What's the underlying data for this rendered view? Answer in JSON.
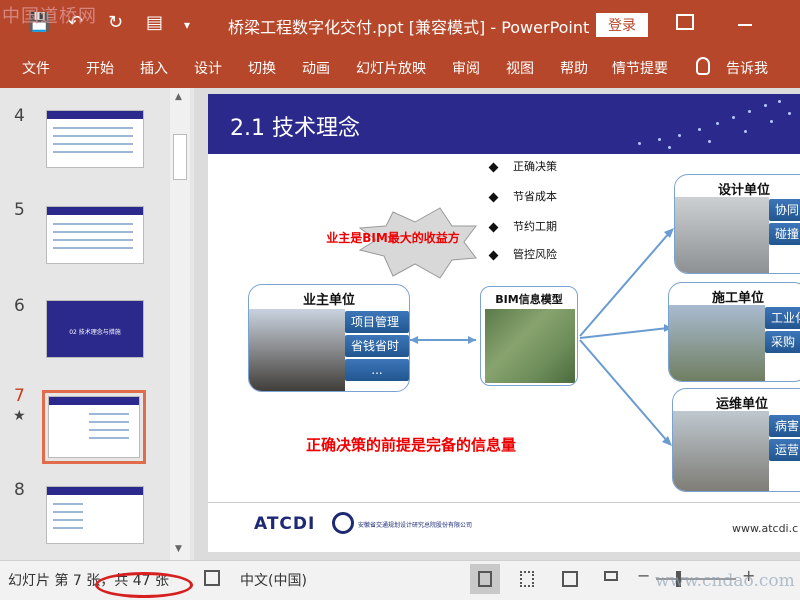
{
  "app": {
    "title": "桥梁工程数字化交付.ppt [兼容模式]  -  PowerPoint",
    "login_label": "登录",
    "watermark": "中国道桥网"
  },
  "ribbon": {
    "tabs": [
      "文件",
      "开始",
      "插入",
      "设计",
      "切换",
      "动画",
      "幻灯片放映",
      "审阅",
      "视图",
      "帮助",
      "情节提要"
    ],
    "tell_me": "告诉我"
  },
  "thumbnails": [
    {
      "num": "4"
    },
    {
      "num": "5"
    },
    {
      "num": "6",
      "caption": "02 技术理念与措施"
    },
    {
      "num": "7",
      "selected": true
    },
    {
      "num": "8"
    }
  ],
  "slide": {
    "title": "2.1 技术理念",
    "bullets": [
      "正确决策",
      "节省成本",
      "节约工期",
      "管控风险"
    ],
    "star_text": "业主是BIM最大的收益方",
    "owner": {
      "title": "业主单位",
      "buttons": [
        "项目管理",
        "省钱省时",
        "..."
      ]
    },
    "bim": {
      "title": "BIM信息模型"
    },
    "design": {
      "title": "设计单位",
      "buttons": [
        "协同",
        "碰撞"
      ]
    },
    "construction": {
      "title": "施工单位",
      "buttons": [
        "工业化",
        "采购"
      ]
    },
    "operation": {
      "title": "运维单位",
      "buttons": [
        "病害",
        "运营"
      ]
    },
    "conclusion": "正确决策的前提是完备的信息量",
    "logo": "ATCDI",
    "institute": "安徽省交通规划设计研究总院股份有限公司",
    "website": "www.atcdi.c"
  },
  "status": {
    "slide_info": "幻灯片 第 7 张，共 47 张",
    "language": "中文(中国)",
    "site_watermark": "www.cndao.com"
  }
}
